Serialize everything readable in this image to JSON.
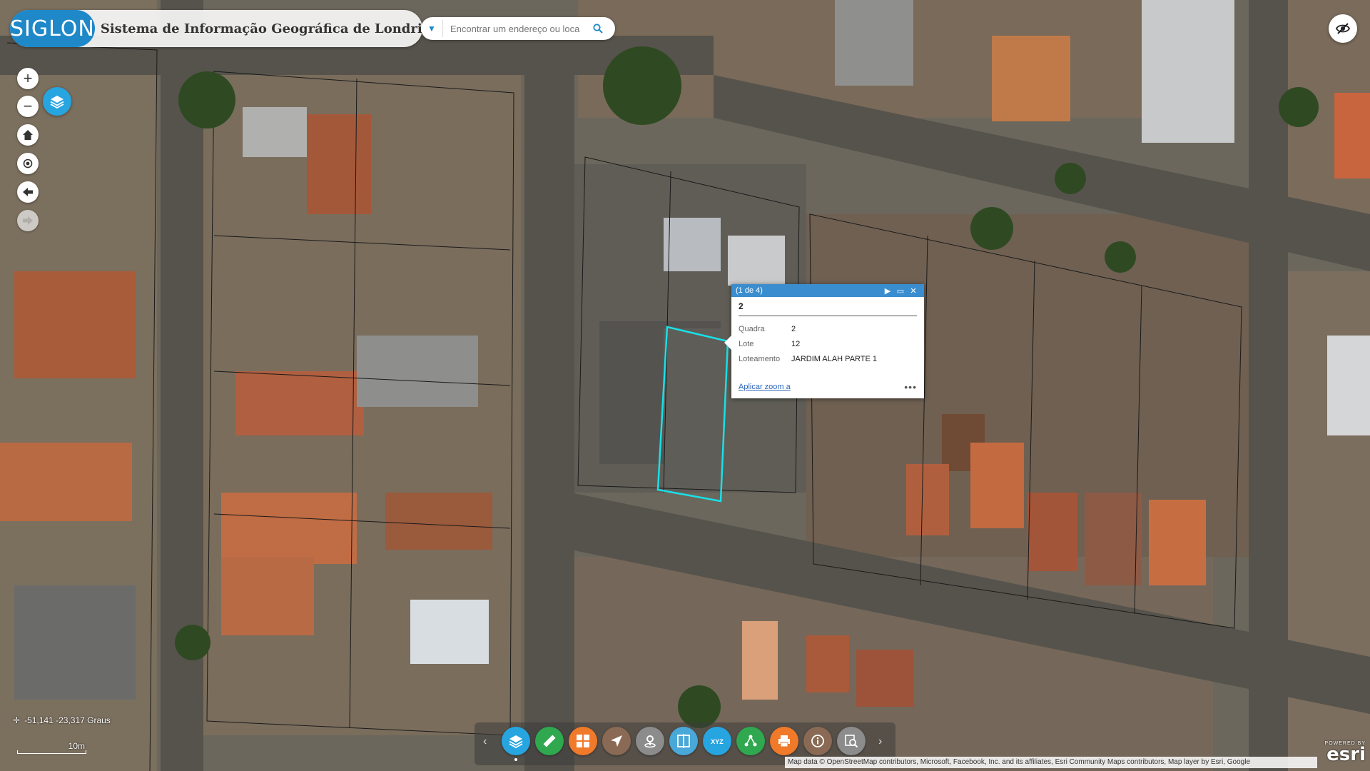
{
  "header": {
    "logo_text": "SIGLON",
    "app_title": "Sistema de Informação Geográfica de Londrina"
  },
  "search": {
    "placeholder": "Encontrar um endereço ou loca"
  },
  "map_controls": {
    "zoom_in": "+",
    "zoom_out": "−"
  },
  "popup": {
    "counter": "(1 de 4)",
    "title": "2",
    "attributes": [
      {
        "label": "Quadra",
        "value": "2"
      },
      {
        "label": "Lote",
        "value": "12"
      },
      {
        "label": "Loteamento",
        "value": "JARDIM ALAH PARTE 1"
      }
    ],
    "zoom_link": "Aplicar zoom a",
    "more": "•••",
    "highlight_color": "#19e0e8"
  },
  "status": {
    "coordinates": "-51,141 -23,317 Graus",
    "scale_label": "10m"
  },
  "toolbar": {
    "tools": [
      {
        "icon": "layers-icon",
        "color": "#27a5e0"
      },
      {
        "icon": "measure-ruler-icon",
        "color": "#2fa84f"
      },
      {
        "icon": "basemap-grid-icon",
        "color": "#f07a2a"
      },
      {
        "icon": "directions-icon",
        "color": "#8a6a54"
      },
      {
        "icon": "location-pin-icon",
        "color": "#8c8c8c"
      },
      {
        "icon": "split-view-icon",
        "color": "#49a8d8"
      },
      {
        "icon": "xyz-coordinates-icon",
        "color": "#27a5e0"
      },
      {
        "icon": "share-icon",
        "color": "#2fa84f"
      },
      {
        "icon": "print-icon",
        "color": "#f07a2a"
      },
      {
        "icon": "info-icon",
        "color": "#8a6a54"
      },
      {
        "icon": "query-search-icon",
        "color": "#8c8c8c"
      }
    ]
  },
  "attribution": {
    "text": "Map data © OpenStreetMap contributors, Microsoft, Facebook, Inc. and its affiliates, Esri Community Maps contributors, Map layer by Esri, Google",
    "powered_by": "POWERED BY",
    "brand": "esri"
  },
  "colors": {
    "accent": "#1e88c8",
    "popup_header": "#3a8ed0"
  }
}
